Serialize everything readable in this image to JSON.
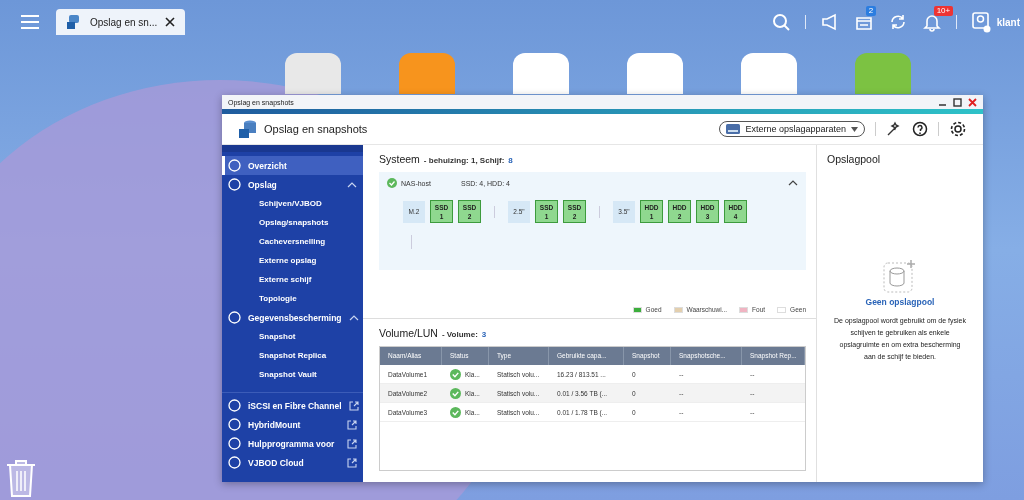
{
  "topbar": {
    "tab": {
      "title": "Opslag en sn...",
      "selected": true
    },
    "tasks_badge": "2",
    "notifications_badge": "10+",
    "user": "klant"
  },
  "window": {
    "title": "Opslag en snapshots",
    "app_title": "Opslag en snapshots",
    "external_button": "Externe opslagapparaten"
  },
  "sidebar": {
    "items": [
      {
        "label": "Overzicht",
        "kind": "page",
        "selected": true
      },
      {
        "label": "Opslag",
        "kind": "group",
        "expanded": true,
        "children": [
          {
            "label": "Schijven/VJBOD",
            "selected": false
          },
          {
            "label": "Opslag/snapshots",
            "selected": false
          },
          {
            "label": "Cacheversnelling",
            "selected": false
          },
          {
            "label": "Externe opslag",
            "selected": false
          },
          {
            "label": "Externe schijf",
            "selected": false
          },
          {
            "label": "Topologie",
            "selected": false
          }
        ]
      },
      {
        "label": "Gegevensbescherming",
        "kind": "group",
        "expanded": true,
        "children": [
          {
            "label": "Snapshot",
            "selected": false
          },
          {
            "label": "Snapshot Replica",
            "selected": false
          },
          {
            "label": "Snapshot Vault",
            "selected": false
          }
        ]
      },
      {
        "label": "iSCSI en Fibre Channel",
        "kind": "external",
        "selected": false
      },
      {
        "label": "HybridMount",
        "kind": "external",
        "selected": false
      },
      {
        "label": "Hulpprogramma voor",
        "kind": "external",
        "selected": false
      },
      {
        "label": "VJBOD Cloud",
        "kind": "external",
        "selected": false
      }
    ]
  },
  "system": {
    "title": "Systeem",
    "summary": "- behuizing: 1, Schijf:",
    "disk_count": "8",
    "host": {
      "label": "NAS-host",
      "ok": true,
      "disks": "SSD: 4, HDD: 4",
      "expanded": true
    },
    "groups": [
      {
        "label": "M.2",
        "disks": [
          {
            "type": "SSD",
            "number": "1",
            "color": "#8fd88f"
          },
          {
            "type": "SSD",
            "number": "2",
            "color": "#8fd88f"
          }
        ]
      },
      {
        "label": "2.5\"",
        "disks": [
          {
            "type": "SSD",
            "number": "1",
            "color": "#8fd88f"
          },
          {
            "type": "SSD",
            "number": "2",
            "color": "#8fd88f"
          }
        ]
      },
      {
        "label": "3.5\"",
        "disks": [
          {
            "type": "HDD",
            "number": "1",
            "color": "#8fd88f"
          },
          {
            "type": "HDD",
            "number": "2",
            "color": "#8fd88f"
          },
          {
            "type": "HDD",
            "number": "3",
            "color": "#8fd88f"
          },
          {
            "type": "HDD",
            "number": "4",
            "color": "#8fd88f"
          }
        ]
      }
    ],
    "legend": [
      {
        "label": "Goed",
        "color": "#3cae3c"
      },
      {
        "label": "Waarschuwi...",
        "color": "#e3cfae"
      },
      {
        "label": "Fout",
        "color": "#f0b4c2"
      },
      {
        "label": "Geen",
        "color": "#ffffff"
      }
    ]
  },
  "volumes": {
    "title": "Volume/LUN",
    "summary": "- Volume:",
    "count": "3",
    "columns": [
      "Naam/Alias",
      "Status",
      "Type",
      "Gebruikte capa...",
      "Snapshot",
      "Snapshotsche...",
      "Snapshot Rep..."
    ],
    "rows": [
      {
        "name": "DataVolume1",
        "status": "Kla...",
        "ok": true,
        "type": "Statisch volu...",
        "capacity": "16.23 / 813.51 ...",
        "snapshot": "0",
        "schedule": "--",
        "replica": "--"
      },
      {
        "name": "DataVolume2",
        "status": "Kla...",
        "ok": true,
        "type": "Statisch volu...",
        "capacity": "0.01 / 3.56 TB (...",
        "snapshot": "0",
        "schedule": "--",
        "replica": "--"
      },
      {
        "name": "DataVolume3",
        "status": "Kla...",
        "ok": true,
        "type": "Statisch volu...",
        "capacity": "0.01 / 1.78 TB (...",
        "snapshot": "0",
        "schedule": "--",
        "replica": "--"
      }
    ]
  },
  "pool": {
    "title": "Opslagpool",
    "empty_title": "Geen opslagpool",
    "description": "De opslagpool wordt gebruikt om de fysiek schijven te gebruiken als enkele opslagruimte en om extra bescherming aan de schijf te bieden."
  }
}
